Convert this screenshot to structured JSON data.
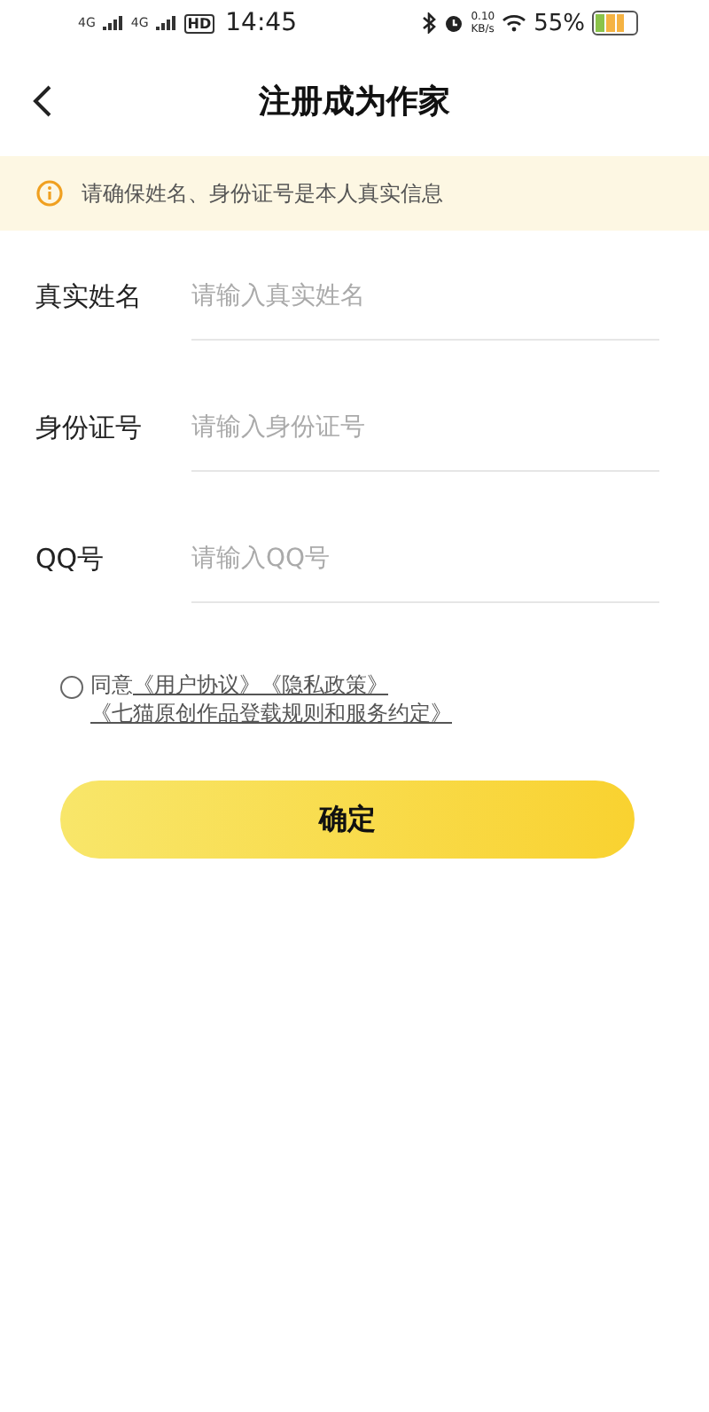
{
  "status_bar": {
    "network_1": "4G",
    "network_2": "4G",
    "hd": "HD",
    "time": "14:45",
    "speed_value": "0.10",
    "speed_unit": "KB/s",
    "battery": "55%"
  },
  "header": {
    "title": "注册成为作家"
  },
  "notice": {
    "text": "请确保姓名、身份证号是本人真实信息"
  },
  "fields": [
    {
      "label": "真实姓名",
      "placeholder": "请输入真实姓名"
    },
    {
      "label": "身份证号",
      "placeholder": "请输入身份证号"
    },
    {
      "label": "QQ号",
      "placeholder": "请输入QQ号"
    }
  ],
  "agreement": {
    "checked": false,
    "prefix": "同意",
    "links": [
      "《用户协议》",
      "《隐私政策》",
      "《七猫原创作品登载规则和服务约定》"
    ]
  },
  "submit_button": "确定"
}
